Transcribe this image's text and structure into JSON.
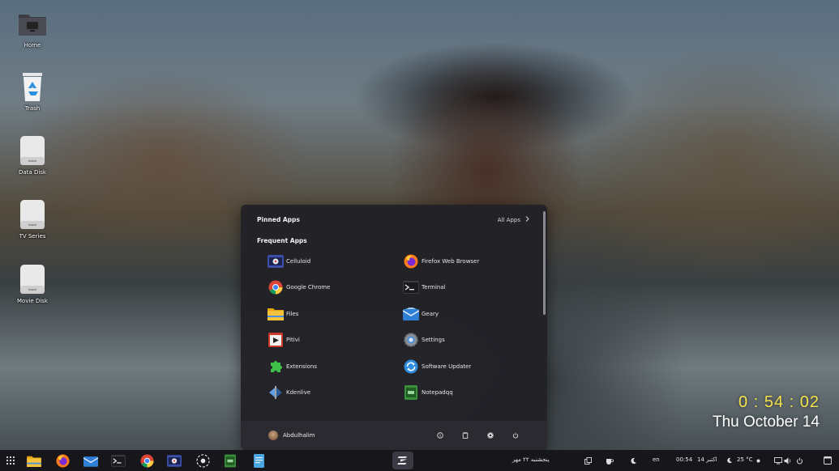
{
  "desktop": {
    "icons": [
      {
        "label": "Home",
        "icon": "folder-icon"
      },
      {
        "label": "Trash",
        "icon": "trash-icon"
      },
      {
        "label": "Data Disk",
        "icon": "drive-icon"
      },
      {
        "label": "TV Series",
        "icon": "drive-icon"
      },
      {
        "label": "Movie Disk",
        "icon": "drive-icon"
      }
    ]
  },
  "clock": {
    "time": "0 : 54 : 02",
    "date": "Thu October 14",
    "time_color": "#f3e24a"
  },
  "menu": {
    "pinned_title": "Pinned Apps",
    "all_apps_label": "All Apps",
    "frequent_title": "Frequent Apps",
    "apps": [
      {
        "name": "Celluloid",
        "icon": "celluloid-icon"
      },
      {
        "name": "Firefox Web Browser",
        "icon": "firefox-icon"
      },
      {
        "name": "Google Chrome",
        "icon": "chrome-icon"
      },
      {
        "name": "Terminal",
        "icon": "terminal-icon"
      },
      {
        "name": "Files",
        "icon": "files-icon"
      },
      {
        "name": "Geary",
        "icon": "geary-icon"
      },
      {
        "name": "Pitivi",
        "icon": "pitivi-icon"
      },
      {
        "name": "Settings",
        "icon": "settings-icon"
      },
      {
        "name": "Extensions",
        "icon": "extensions-icon"
      },
      {
        "name": "Software Updater",
        "icon": "software-updater-icon"
      },
      {
        "name": "Kdenlive",
        "icon": "kdenlive-icon"
      },
      {
        "name": "Notepadqq",
        "icon": "notepadqq-icon"
      }
    ],
    "user_name": "Abdulhalim",
    "footer_actions": [
      "info-icon",
      "clipboard-icon",
      "gear-icon",
      "power-icon"
    ]
  },
  "taskbar": {
    "apps": [
      "files-icon",
      "firefox-icon",
      "mail-icon",
      "terminal-icon",
      "chrome-icon",
      "celluloid-icon",
      "pinwheel-icon",
      "notepad-icon",
      "document-icon"
    ],
    "persian_date": "پنجشنبه ۲۲ مهر",
    "language": "en",
    "clock": "00:54",
    "date_label": "14 اکتبر",
    "weather": "25 °C",
    "accent": "#4aa6e0"
  }
}
